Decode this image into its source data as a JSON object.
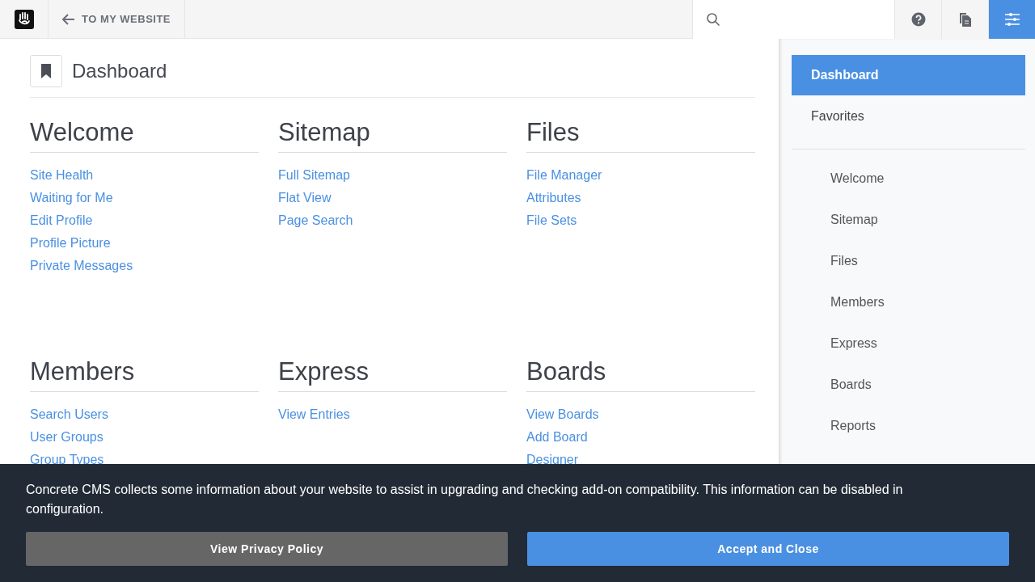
{
  "toolbar": {
    "back_link": "TO MY WEBSITE",
    "buttons": [
      {
        "kind": "help",
        "selected": false
      },
      {
        "kind": "pages",
        "selected": false
      },
      {
        "kind": "settings",
        "selected": true
      }
    ]
  },
  "page": {
    "title": "Dashboard",
    "sections": [
      {
        "title": "Welcome",
        "links": [
          "Site Health",
          "Waiting for Me",
          "Edit Profile",
          "Profile Picture",
          "Private Messages"
        ]
      },
      {
        "title": "Sitemap",
        "links": [
          "Full Sitemap",
          "Flat View",
          "Page Search"
        ]
      },
      {
        "title": "Files",
        "links": [
          "File Manager",
          "Attributes",
          "File Sets"
        ]
      },
      {
        "title": "Members",
        "links": [
          "Search Users",
          "User Groups",
          "Group Types"
        ]
      },
      {
        "title": "Express",
        "links": [
          "View Entries"
        ]
      },
      {
        "title": "Boards",
        "links": [
          "View Boards",
          "Add Board",
          "Designer"
        ]
      }
    ]
  },
  "sidebar": {
    "items": [
      {
        "label": "Dashboard",
        "selected": true
      },
      {
        "label": "Favorites",
        "selected": false
      }
    ],
    "sub_items": [
      "Welcome",
      "Sitemap",
      "Files",
      "Members",
      "Express",
      "Boards",
      "Reports"
    ]
  },
  "banner": {
    "text": "Concrete CMS collects some information about your website to assist in upgrading and checking add-on compatibility. This information can be disabled in configuration.",
    "buttons": [
      {
        "label": "View Privacy Policy",
        "kind": "secondary"
      },
      {
        "label": "Accept and Close",
        "kind": "primary"
      }
    ]
  }
}
